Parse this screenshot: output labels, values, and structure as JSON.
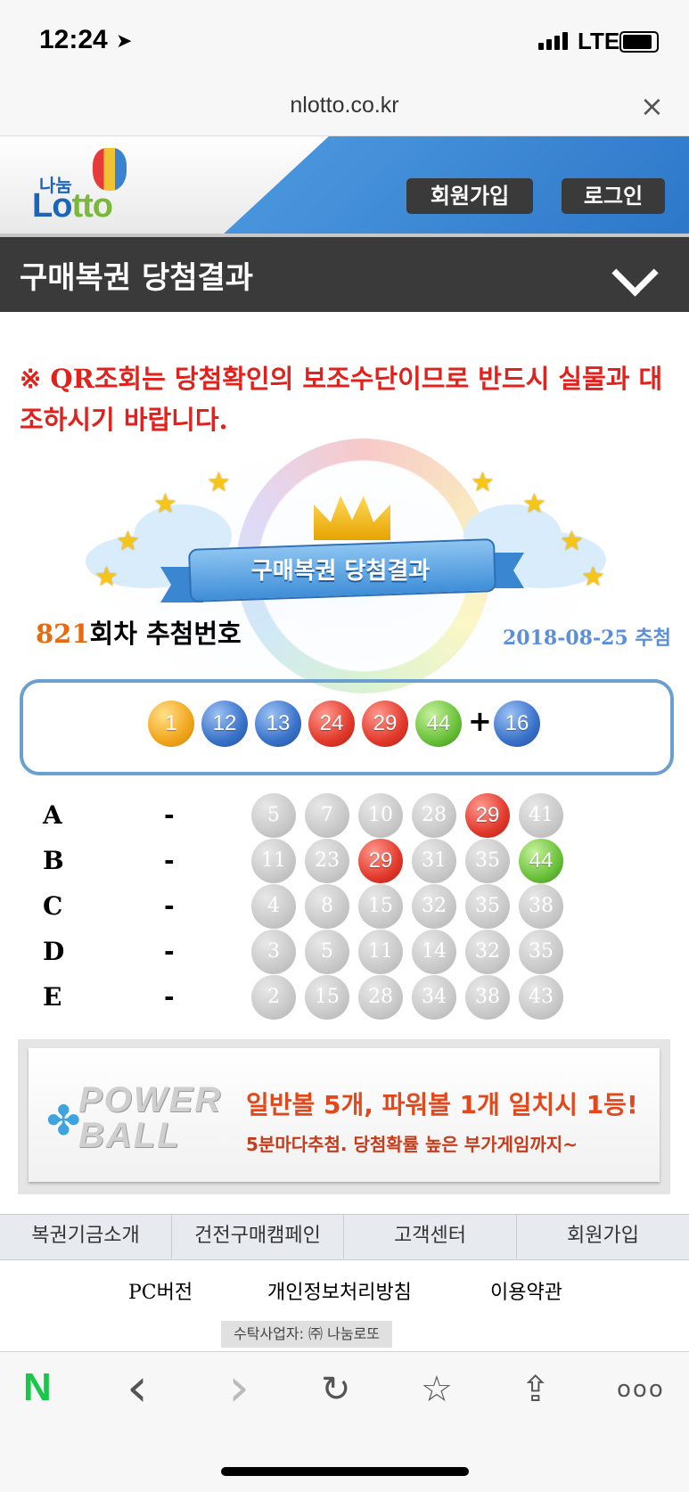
{
  "status": {
    "time": "12:24",
    "network": "LTE"
  },
  "browser": {
    "url": "nlotto.co.kr",
    "close": "×"
  },
  "header": {
    "logo_small": "나눔",
    "logo_main_prefix": "Lo",
    "logo_main_accent": "tto",
    "join_label": "회원가입",
    "login_label": "로그인"
  },
  "title": "구매복권 당첨결과",
  "notice": "※ QR조회는 당첨확인의 보조수단이므로 반드시 실물과 대조하시기 바랍니다.",
  "banner": {
    "ribbon": "구매복권 당첨결과"
  },
  "round": {
    "number": "821",
    "suffix": "회차 추첨번호",
    "date": "2018-08-25 추첨"
  },
  "winning": {
    "numbers": [
      "1",
      "12",
      "13",
      "24",
      "29",
      "44"
    ],
    "plus": "+",
    "bonus": "16",
    "colors": [
      "yellow",
      "blue",
      "blue",
      "red",
      "red",
      "green",
      "blue"
    ]
  },
  "games": [
    {
      "label": "A",
      "dash": "-",
      "numbers": [
        "5",
        "7",
        "10",
        "28",
        "29",
        "41"
      ],
      "match": [
        false,
        false,
        false,
        false,
        "red",
        false
      ]
    },
    {
      "label": "B",
      "dash": "-",
      "numbers": [
        "11",
        "23",
        "29",
        "31",
        "35",
        "44"
      ],
      "match": [
        false,
        false,
        "red",
        false,
        false,
        "green"
      ]
    },
    {
      "label": "C",
      "dash": "-",
      "numbers": [
        "4",
        "8",
        "15",
        "32",
        "35",
        "38"
      ],
      "match": [
        false,
        false,
        false,
        false,
        false,
        false
      ]
    },
    {
      "label": "D",
      "dash": "-",
      "numbers": [
        "3",
        "5",
        "11",
        "14",
        "32",
        "35"
      ],
      "match": [
        false,
        false,
        false,
        false,
        false,
        false
      ]
    },
    {
      "label": "E",
      "dash": "-",
      "numbers": [
        "2",
        "15",
        "28",
        "34",
        "38",
        "43"
      ],
      "match": [
        false,
        false,
        false,
        false,
        false,
        false
      ]
    }
  ],
  "ad": {
    "logo_line1": "POWER",
    "logo_line2": "BALL",
    "main": "일반볼 5개, 파워볼 1개 일치시 1등!",
    "sub": "5분마다추첨. 당첨확률 높은 부가게임까지~"
  },
  "footer": {
    "nav": [
      "복권기금소개",
      "건전구매캠페인",
      "고객센터",
      "회원가입"
    ],
    "links": [
      "PC버전",
      "개인정보처리방침",
      "이용약관"
    ],
    "trust": "수탁사업자: ㈜ 나눔로또"
  },
  "toolbar": {
    "naver": "N",
    "back": "‹",
    "forward": "›",
    "refresh": "↻",
    "bookmark": "☆",
    "share": "⇪",
    "more": "ooo"
  }
}
